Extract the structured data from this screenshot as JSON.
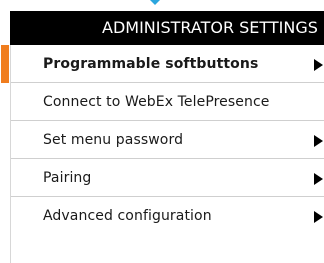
{
  "header": {
    "title": "ADMINISTRATOR SETTINGS"
  },
  "menu": {
    "items": [
      {
        "label": "Programmable softbuttons",
        "has_submenu": true,
        "selected": true
      },
      {
        "label": "Connect to WebEx TelePresence",
        "has_submenu": false,
        "selected": false
      },
      {
        "label": "Set menu password",
        "has_submenu": true,
        "selected": false
      },
      {
        "label": "Pairing",
        "has_submenu": true,
        "selected": false
      },
      {
        "label": "Advanced configuration",
        "has_submenu": true,
        "selected": false
      }
    ]
  },
  "colors": {
    "accent": "#f07d1e",
    "titlebar": "#000000",
    "pointer": "#2ba6de"
  }
}
